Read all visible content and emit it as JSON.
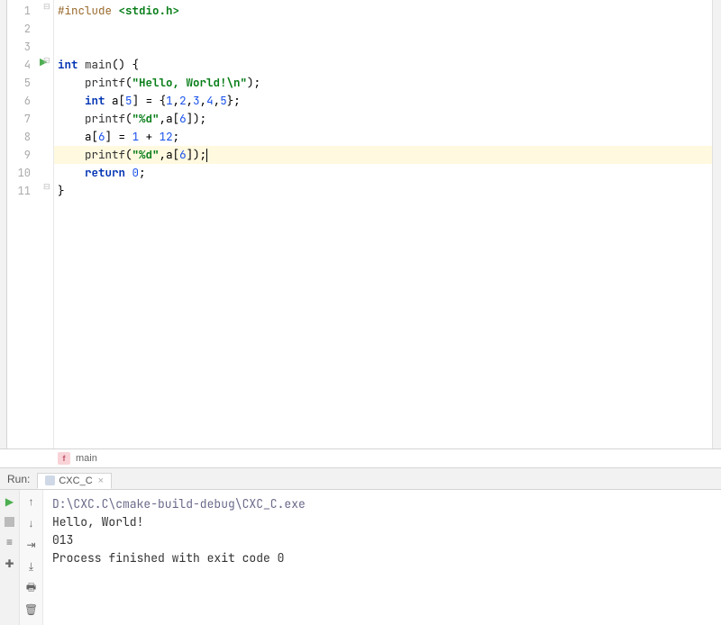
{
  "code": {
    "lines": [
      {
        "n": 1
      },
      {
        "n": 2
      },
      {
        "n": 3
      },
      {
        "n": 4
      },
      {
        "n": 5
      },
      {
        "n": 6
      },
      {
        "n": 7
      },
      {
        "n": 8
      },
      {
        "n": 9
      },
      {
        "n": 10
      },
      {
        "n": 11
      }
    ],
    "l1_pp": "#include",
    "l1_inc": "<stdio.h>",
    "l4_kw1": "int",
    "l4_fn": "main",
    "l4_rest": "() {",
    "l5_fn": "printf",
    "l5_str": "\"Hello, World!\\n\"",
    "l5_end": ");",
    "l6_kw": "int",
    "l6_arr": " a[",
    "l6_n5": "5",
    "l6_mid": "] = {",
    "l6_v1": "1",
    "l6_c": ",",
    "l6_v2": "2",
    "l6_v3": "3",
    "l6_v4": "4",
    "l6_v5": "5",
    "l6_end": "};",
    "l7_fn": "printf",
    "l7_str": "\"%d\"",
    "l7_mid": ",a[",
    "l7_n6": "6",
    "l7_end": "]);",
    "l8_a": "a[",
    "l8_n6": "6",
    "l8_mid": "] = ",
    "l8_v1": "1",
    "l8_plus": " + ",
    "l8_v12": "12",
    "l8_end": ";",
    "l9_fn": "printf",
    "l9_str": "\"%d\"",
    "l9_mid": ",a[",
    "l9_n6": "6",
    "l9_end": "]);",
    "l10_kw": "return",
    "l10_sp": " ",
    "l10_v": "0",
    "l10_end": ";",
    "l11": "}"
  },
  "breadcrumb": {
    "icon": "f",
    "label": "main"
  },
  "run": {
    "label": "Run:",
    "tab_name": "CXC_C",
    "output": {
      "path": "D:\\CXC.C\\cmake-build-debug\\CXC_C.exe",
      "line2": "Hello, World!",
      "line3": "013",
      "proc": "Process finished with exit code 0"
    }
  }
}
